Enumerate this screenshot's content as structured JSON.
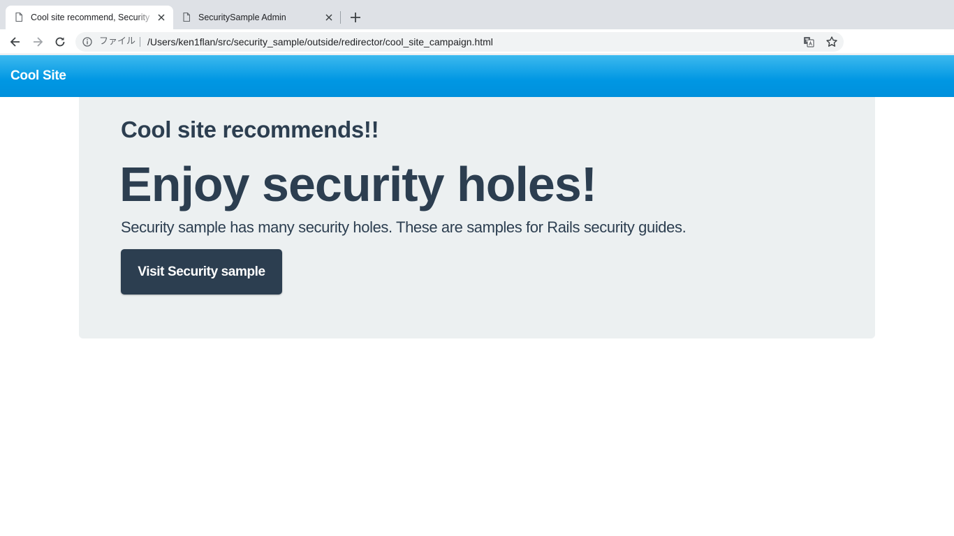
{
  "browser": {
    "tabs": [
      {
        "title": "Cool site recommend, Security",
        "active": true
      },
      {
        "title": "SecuritySample Admin",
        "active": false
      }
    ],
    "omnibox": {
      "file_label": "ファイル",
      "url": "/Users/ken1flan/src/security_sample/outside/redirector/cool_site_campaign.html"
    },
    "icons": [
      "doc-icon",
      "close-icon",
      "new-tab-plus-icon",
      "back-arrow-icon",
      "forward-arrow-icon",
      "reload-icon",
      "info-icon",
      "translate-icon",
      "star-icon",
      "cloud-extension-icon",
      "pocket-extension-icon",
      "profile-avatar",
      "more-menu-icon"
    ]
  },
  "navbar": {
    "brand": "Cool Site",
    "color": "#0098e4"
  },
  "jumbotron": {
    "subtitle": "Cool site recommends!!",
    "title": "Enjoy security holes!",
    "lead": "Security sample has many security holes. These are samples for Rails security guides.",
    "button_label": "Visit Security sample",
    "background": "#ecf0f1",
    "text_color": "#2c3e50"
  }
}
